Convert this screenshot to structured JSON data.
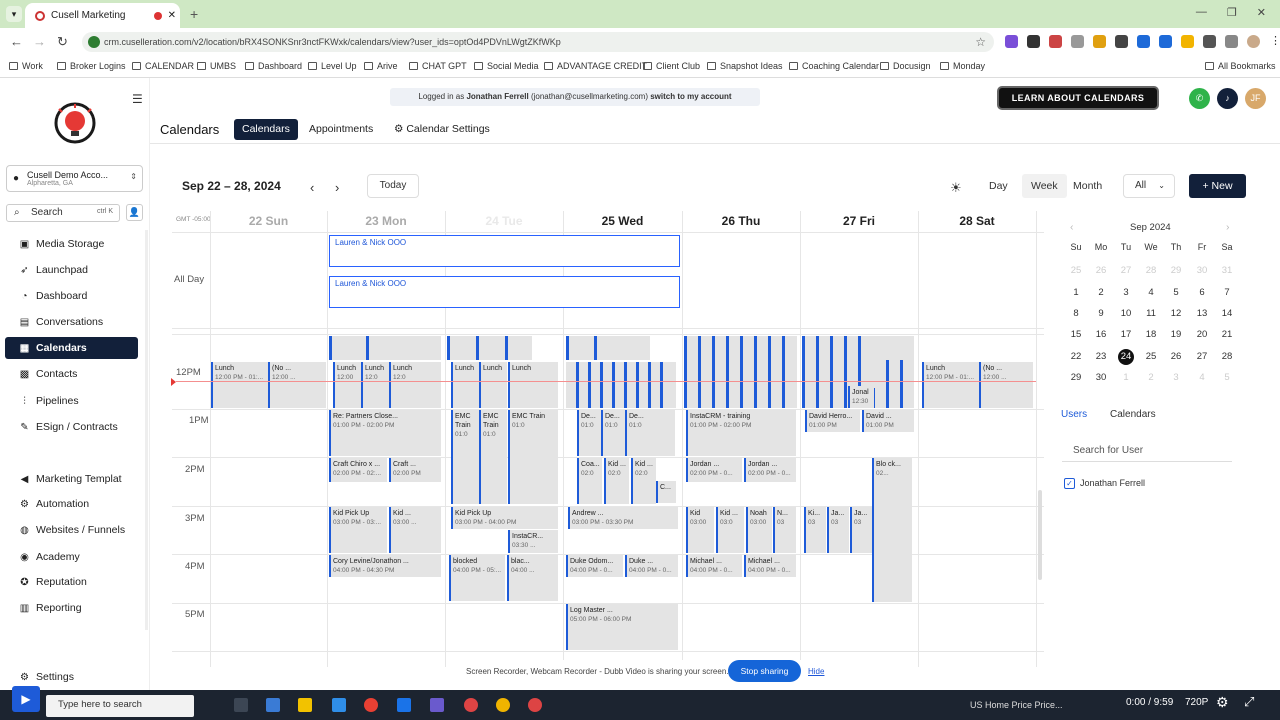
{
  "browser": {
    "tab_title": "Cusell Marketing",
    "new_tab": "+",
    "url": "crm.cuselleration.com/v2/location/bRX4SONKSnr3nctFKWxk/calendars/view?user_ids=optOd4PDVnLWgtZKfWKp",
    "bookmarks": [
      "Work",
      "Broker Logins",
      "CALENDAR",
      "UMBS",
      "Dashboard",
      "Level Up",
      "Arive",
      "CHAT GPT",
      "Social Media",
      "ADVANTAGE CREDIT",
      "Client Club",
      "Snapshot Ideas",
      "Coaching Calendar",
      "Docusign",
      "Monday"
    ],
    "all_bookmarks": "All Bookmarks"
  },
  "sidebar": {
    "account_name": "Cusell Demo Acco...",
    "account_location": "Alpharetta, GA",
    "search_label": "Search",
    "search_shortcut": "ctrl K",
    "items": [
      {
        "label": "Media Storage",
        "icon": "image-icon"
      },
      {
        "label": "Launchpad",
        "icon": "rocket-icon"
      },
      {
        "label": "Dashboard",
        "icon": "gauge-icon"
      },
      {
        "label": "Conversations",
        "icon": "chat-icon"
      },
      {
        "label": "Calendars",
        "icon": "calendar-icon",
        "active": true
      },
      {
        "label": "Contacts",
        "icon": "contacts-icon"
      },
      {
        "label": "Pipelines",
        "icon": "funnel-icon"
      },
      {
        "label": "ESign / Contracts",
        "icon": "signature-icon"
      },
      {
        "label": "Marketing Templat",
        "icon": "megaphone-icon"
      },
      {
        "label": "Automation",
        "icon": "automation-icon"
      },
      {
        "label": "Websites / Funnels",
        "icon": "globe-icon"
      },
      {
        "label": "Academy",
        "icon": "academy-icon"
      },
      {
        "label": "Reputation",
        "icon": "star-icon"
      },
      {
        "label": "Reporting",
        "icon": "chart-icon"
      }
    ],
    "settings": "Settings"
  },
  "header": {
    "login_text": "Logged in as",
    "login_user": "Jonathan Ferrell",
    "login_email": "(jonathan@cusellmarketing.com)",
    "switch_link": "switch to my account",
    "learn_button": "LEARN ABOUT CALENDARS",
    "avatar_initials": "JF"
  },
  "subnav": {
    "title": "Calendars",
    "tabs": [
      "Calendars",
      "Appointments",
      "Calendar Settings"
    ]
  },
  "toolbar": {
    "date_range": "Sep 22 – 28, 2024",
    "today": "Today",
    "views": [
      "Day",
      "Week",
      "Month"
    ],
    "filter": "All",
    "new_button": "+ New"
  },
  "calendar": {
    "gmt": "GMT -05:00",
    "days": [
      "22 Sun",
      "23 Mon",
      "24 Tue",
      "25 Wed",
      "26 Thu",
      "27 Fri",
      "28 Sat"
    ],
    "all_day_label": "All Day",
    "all_day_events": [
      "Lauren & Nick OOO",
      "Lauren & Nick OOO"
    ],
    "hours": [
      "12PM",
      "1PM",
      "2PM",
      "3PM",
      "4PM",
      "5PM"
    ],
    "events": [
      {
        "title": "Lunch",
        "time": "12:00 PM - 01:..."
      },
      {
        "title": "(No ...",
        "time": "12:00 ..."
      },
      {
        "title": "Lunch",
        "time": "12:00"
      },
      {
        "title": "Lunch",
        "time": "12:0"
      },
      {
        "title": "Lunch",
        "time": "12:0"
      },
      {
        "title": "Lunch",
        "time": ""
      },
      {
        "title": "Lunch",
        "time": ""
      },
      {
        "title": "Lunch",
        "time": ""
      },
      {
        "title": "Lunch",
        "time": "12:00 PM - 01:..."
      },
      {
        "title": "(No ...",
        "time": "12:00 ..."
      },
      {
        "title": "Re: Partners Close...",
        "time": "01:00 PM - 02:00 PM"
      },
      {
        "title": "EMC Train",
        "time": "01:0"
      },
      {
        "title": "EMC Train",
        "time": "01:0"
      },
      {
        "title": "EMC Train",
        "time": "01:0"
      },
      {
        "title": "De...",
        "time": "01:0"
      },
      {
        "title": "De...",
        "time": "01:0"
      },
      {
        "title": "De...",
        "time": "01:0"
      },
      {
        "title": "InstaCRM - training",
        "time": "01:00 PM - 02:00 PM"
      },
      {
        "title": "David Herro...",
        "time": "01:00 PM"
      },
      {
        "title": "David ...",
        "time": "01:00 PM"
      },
      {
        "title": "Craft Chiro x ...",
        "time": "02:00 PM - 02:..."
      },
      {
        "title": "Craft ...",
        "time": "02:00 PM"
      },
      {
        "title": "Coa...",
        "time": "02:0"
      },
      {
        "title": "Kid ...",
        "time": "02:0"
      },
      {
        "title": "Kid ...",
        "time": "02:0"
      },
      {
        "title": "C...",
        "time": ""
      },
      {
        "title": "Jordan ...",
        "time": "02:00 PM - 0..."
      },
      {
        "title": "Jordan ...",
        "time": "02:00 PM - 0..."
      },
      {
        "title": "Blo ck...",
        "time": "02..."
      },
      {
        "title": "Kid Pick Up",
        "time": "03:00 PM - 03:..."
      },
      {
        "title": "Kid ...",
        "time": "03:00 ..."
      },
      {
        "title": "Kid Pick Up",
        "time": "03:00 PM - 04:00 PM"
      },
      {
        "title": "InstaCR...",
        "time": "03:30 ..."
      },
      {
        "title": "Andrew ...",
        "time": "03:00 PM - 03:30 PM"
      },
      {
        "title": "Kid",
        "time": "03:00"
      },
      {
        "title": "Kid ...",
        "time": "03:0"
      },
      {
        "title": "Noah",
        "time": "03:00"
      },
      {
        "title": "N...",
        "time": "03"
      },
      {
        "title": "Ki...",
        "time": "03"
      },
      {
        "title": "Ja...",
        "time": "03"
      },
      {
        "title": "Ja...",
        "time": "03"
      },
      {
        "title": "Cory Levine/Jonathon ...",
        "time": "04:00 PM - 04:30 PM"
      },
      {
        "title": "blocked",
        "time": "04:00 PM - 05:..."
      },
      {
        "title": "blac...",
        "time": "04:00 ..."
      },
      {
        "title": "Duke Odom...",
        "time": "04:00 PM - 0..."
      },
      {
        "title": "Duke ...",
        "time": "04:00 PM - 0..."
      },
      {
        "title": "Michael ...",
        "time": "04:00 PM - 0..."
      },
      {
        "title": "Michael ...",
        "time": "04:00 PM - 0..."
      },
      {
        "title": "Log Master ...",
        "time": "05:00 PM - 06:00 PM"
      },
      {
        "title": "Jonal",
        "time": "12:30"
      }
    ]
  },
  "mini_calendar": {
    "month": "Sep 2024",
    "weekdays": [
      "Su",
      "Mo",
      "Tu",
      "We",
      "Th",
      "Fr",
      "Sa"
    ],
    "weeks": [
      [
        "25",
        "26",
        "27",
        "28",
        "29",
        "30",
        "31"
      ],
      [
        "1",
        "2",
        "3",
        "4",
        "5",
        "6",
        "7"
      ],
      [
        "8",
        "9",
        "10",
        "11",
        "12",
        "13",
        "14"
      ],
      [
        "15",
        "16",
        "17",
        "18",
        "19",
        "20",
        "21"
      ],
      [
        "22",
        "23",
        "24",
        "25",
        "26",
        "27",
        "28"
      ],
      [
        "29",
        "30",
        "1",
        "2",
        "3",
        "4",
        "5"
      ]
    ],
    "today": "24"
  },
  "panel": {
    "tabs": [
      "Users",
      "Calendars"
    ],
    "search_placeholder": "Search for User",
    "user": "Jonathan Ferrell"
  },
  "share_bar": {
    "text": "Screen Recorder, Webcam Recorder - Dubb Video is sharing your screen.",
    "stop": "Stop sharing",
    "hide": "Hide"
  },
  "taskbar": {
    "search": "Type here to search",
    "news": "US Home Price Price...",
    "time_display": "0:00 / 9:59",
    "quality": "720P"
  }
}
